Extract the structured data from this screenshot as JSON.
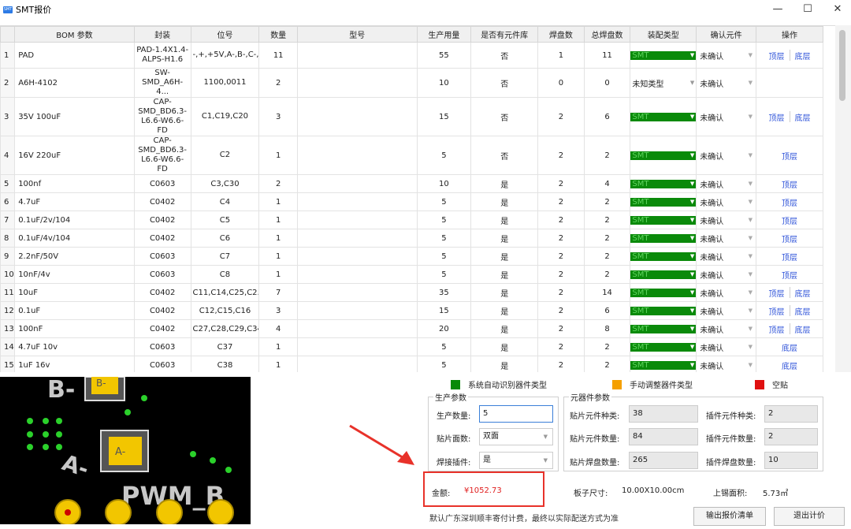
{
  "window": {
    "app_icon": "SMT",
    "title": "SMT报价",
    "minimize": "—",
    "maximize": "☐",
    "close": "✕"
  },
  "table": {
    "headers": [
      "",
      "BOM 参数",
      "封装",
      "位号",
      "数量",
      "型号",
      "生产用量",
      "是否有元件库",
      "焊盘数",
      "总焊盘数",
      "装配类型",
      "确认元件",
      "操作"
    ],
    "rows": [
      {
        "idx": "1",
        "bom": "PAD",
        "pkg": "PAD-1.4X1.4-ALPS-H1.6",
        "ref": "-,+,+5V,A-,B-,C-,F1,...",
        "qty": "11",
        "model": "",
        "use": "55",
        "lib": "否",
        "pads": "1",
        "total": "11",
        "asm": "SMT",
        "conf": "未确认",
        "ops": [
          "顶层",
          "底层"
        ]
      },
      {
        "idx": "2",
        "bom": "A6H-4102",
        "pkg": "SW-SMD_A6H-4...",
        "ref": "1100,0011",
        "qty": "2",
        "model": "",
        "use": "10",
        "lib": "否",
        "pads": "0",
        "total": "0",
        "asm": "未知类型",
        "conf": "未确认",
        "ops": []
      },
      {
        "idx": "3",
        "bom": "35V 100uF",
        "pkg": "CAP-SMD_BD6.3-L6.6-W6.6-FD",
        "ref": "C1,C19,C20",
        "qty": "3",
        "model": "",
        "use": "15",
        "lib": "否",
        "pads": "2",
        "total": "6",
        "asm": "SMT",
        "conf": "未确认",
        "ops": [
          "顶层",
          "底层"
        ]
      },
      {
        "idx": "4",
        "bom": "16V 220uF",
        "pkg": "CAP-SMD_BD6.3-L6.6-W6.6-FD",
        "ref": "C2",
        "qty": "1",
        "model": "",
        "use": "5",
        "lib": "否",
        "pads": "2",
        "total": "2",
        "asm": "SMT",
        "conf": "未确认",
        "ops": [
          "顶层"
        ]
      },
      {
        "idx": "5",
        "bom": "100nf",
        "pkg": "C0603",
        "ref": "C3,C30",
        "qty": "2",
        "model": "",
        "use": "10",
        "lib": "是",
        "pads": "2",
        "total": "4",
        "asm": "SMT",
        "conf": "未确认",
        "ops": [
          "顶层"
        ]
      },
      {
        "idx": "6",
        "bom": "4.7uF",
        "pkg": "C0402",
        "ref": "C4",
        "qty": "1",
        "model": "",
        "use": "5",
        "lib": "是",
        "pads": "2",
        "total": "2",
        "asm": "SMT",
        "conf": "未确认",
        "ops": [
          "顶层"
        ]
      },
      {
        "idx": "7",
        "bom": "0.1uF/2v/104",
        "pkg": "C0402",
        "ref": "C5",
        "qty": "1",
        "model": "",
        "use": "5",
        "lib": "是",
        "pads": "2",
        "total": "2",
        "asm": "SMT",
        "conf": "未确认",
        "ops": [
          "顶层"
        ]
      },
      {
        "idx": "8",
        "bom": "0.1uF/4v/104",
        "pkg": "C0402",
        "ref": "C6",
        "qty": "1",
        "model": "",
        "use": "5",
        "lib": "是",
        "pads": "2",
        "total": "2",
        "asm": "SMT",
        "conf": "未确认",
        "ops": [
          "顶层"
        ]
      },
      {
        "idx": "9",
        "bom": "2.2nF/50V",
        "pkg": "C0603",
        "ref": "C7",
        "qty": "1",
        "model": "",
        "use": "5",
        "lib": "是",
        "pads": "2",
        "total": "2",
        "asm": "SMT",
        "conf": "未确认",
        "ops": [
          "顶层"
        ]
      },
      {
        "idx": "10",
        "bom": "10nF/4v",
        "pkg": "C0603",
        "ref": "C8",
        "qty": "1",
        "model": "",
        "use": "5",
        "lib": "是",
        "pads": "2",
        "total": "2",
        "asm": "SMT",
        "conf": "未确认",
        "ops": [
          "顶层"
        ]
      },
      {
        "idx": "11",
        "bom": "10uF",
        "pkg": "C0402",
        "ref": "C11,C14,C25,C2...",
        "qty": "7",
        "model": "",
        "use": "35",
        "lib": "是",
        "pads": "2",
        "total": "14",
        "asm": "SMT",
        "conf": "未确认",
        "ops": [
          "顶层",
          "底层"
        ]
      },
      {
        "idx": "12",
        "bom": "0.1uF",
        "pkg": "C0402",
        "ref": "C12,C15,C16",
        "qty": "3",
        "model": "",
        "use": "15",
        "lib": "是",
        "pads": "2",
        "total": "6",
        "asm": "SMT",
        "conf": "未确认",
        "ops": [
          "顶层",
          "底层"
        ]
      },
      {
        "idx": "13",
        "bom": "100nF",
        "pkg": "C0402",
        "ref": "C27,C28,C29,C34",
        "qty": "4",
        "model": "",
        "use": "20",
        "lib": "是",
        "pads": "2",
        "total": "8",
        "asm": "SMT",
        "conf": "未确认",
        "ops": [
          "顶层",
          "底层"
        ]
      },
      {
        "idx": "14",
        "bom": "4.7uF 10v",
        "pkg": "C0603",
        "ref": "C37",
        "qty": "1",
        "model": "",
        "use": "5",
        "lib": "是",
        "pads": "2",
        "total": "2",
        "asm": "SMT",
        "conf": "未确认",
        "ops": [
          "底层"
        ]
      },
      {
        "idx": "15",
        "bom": "1uF 16v",
        "pkg": "C0603",
        "ref": "C38",
        "qty": "1",
        "model": "",
        "use": "5",
        "lib": "是",
        "pads": "2",
        "total": "2",
        "asm": "SMT",
        "conf": "未确认",
        "ops": [
          "底层"
        ]
      }
    ]
  },
  "pcb_preview": {
    "labels": {
      "b_minus_left": "B-",
      "b_minus_chip": "B-",
      "a_minus_chip": "A-",
      "a_minus": "A-",
      "pwm_b": "PWM_B"
    }
  },
  "legend": {
    "auto": {
      "label": "系统自动识别器件类型",
      "color": "#078a07"
    },
    "manual": {
      "label": "手动调整器件类型",
      "color": "#f5a000"
    },
    "empty": {
      "label": "空贴",
      "color": "#e01010"
    }
  },
  "production": {
    "title": "生产参数",
    "qty_label": "生产数量:",
    "qty_value": "5",
    "sides_label": "贴片面数:",
    "sides_value": "双面",
    "solder_label": "焊接插件:",
    "solder_value": "是"
  },
  "components": {
    "title": "元器件参数",
    "smd_types_label": "贴片元件种类:",
    "smd_types_value": "38",
    "tht_types_label": "插件元件种类:",
    "tht_types_value": "2",
    "smd_count_label": "贴片元件数量:",
    "smd_count_value": "84",
    "tht_count_label": "插件元件数量:",
    "tht_count_value": "2",
    "smd_pads_label": "贴片焊盘数量:",
    "smd_pads_value": "265",
    "tht_pads_label": "插件焊盘数量:",
    "tht_pads_value": "10"
  },
  "amount": {
    "label": "金额:",
    "value": "¥1052.73"
  },
  "board": {
    "size_label": "板子尺寸:",
    "size_value": "10.00X10.00cm",
    "area_label": "上锡面积:",
    "area_value": "5.73㎡"
  },
  "footer": {
    "shipping_note": "默认广东深圳顺丰寄付计费，最终以实际配送方式为准",
    "export_button": "输出报价清单",
    "exit_button": "退出计价"
  },
  "colors": {
    "smt_green": "#0a8a0a",
    "link_blue": "#2b50d8",
    "amount_red": "#e02020",
    "annotation_red": "#e8322a"
  }
}
